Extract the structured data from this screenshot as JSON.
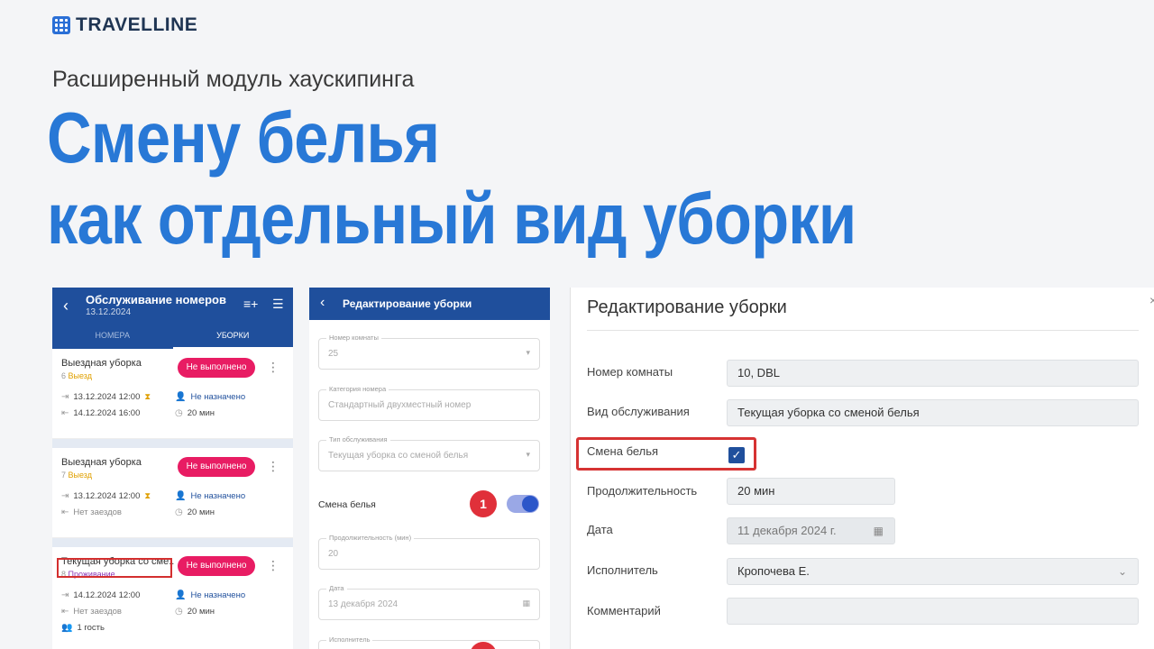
{
  "brand": {
    "name": "TRAVELLINE"
  },
  "subtitle": "Расширенный модуль хаускипинга",
  "headline": {
    "line1": "Смену белья",
    "line2": "как отдельный вид уборки"
  },
  "mobile_list": {
    "title": "Обслуживание номеров",
    "date": "13.12.2024",
    "tabs": [
      "НОМЕРА",
      "УБОРКИ"
    ],
    "cards": [
      {
        "name": "Выездная уборка",
        "room": "6",
        "type": "Выезд",
        "status": "Не выполнено",
        "line1_left": "13.12.2024 12:00",
        "line1_right": "Не назначено",
        "line2_left": "14.12.2024 16:00",
        "line2_right": "20 мин",
        "line3_left": ""
      },
      {
        "name": "Выездная уборка",
        "room": "7",
        "type": "Выезд",
        "status": "Не выполнено",
        "line1_left": "13.12.2024 12:00",
        "line1_right": "Не назначено",
        "line2_left": "Нет заездов",
        "line2_right": "20 мин",
        "line3_left": ""
      },
      {
        "name": "Текущая уборка со сме..",
        "room": "8",
        "type": "Проживание",
        "status": "Не выполнено",
        "line1_left": "14.12.2024 12:00",
        "line1_right": "Не назначено",
        "line2_left": "Нет заездов",
        "line2_right": "20 мин",
        "line3_left": "1 гость"
      }
    ]
  },
  "mobile_edit": {
    "title": "Редактирование уборки",
    "fields": [
      {
        "label": "Номер комнаты",
        "value": "25"
      },
      {
        "label": "Категория номера",
        "value": "Стандартный двухместный номер"
      },
      {
        "label": "Тип обслуживания",
        "value": "Текущая уборка со сменой белья"
      }
    ],
    "switch_label": "Смена белья",
    "switch_on": true,
    "badge": "1",
    "fields2": [
      {
        "label": "Продолжительность (мин)",
        "value": "20"
      },
      {
        "label": "Дата",
        "value": "13 декабря 2024"
      },
      {
        "label": "Исполнитель",
        "value": ""
      }
    ]
  },
  "desktop_edit": {
    "title": "Редактирование уборки",
    "rows": [
      {
        "label": "Номер комнаты",
        "value": "10, DBL"
      },
      {
        "label": "Вид обслуживания",
        "value": "Текущая уборка со сменой белья"
      },
      {
        "label": "Смена белья",
        "value": ""
      },
      {
        "label": "Продолжительность",
        "value": "20 мин"
      },
      {
        "label": "Дата",
        "value": "11 декабря 2024 г."
      },
      {
        "label": "Исполнитель",
        "value": "Кропочева Е."
      },
      {
        "label": "Комментарий",
        "value": ""
      }
    ],
    "linen_checked": true
  },
  "colors": {
    "accent": "#2878d6",
    "header": "#1f4f9c",
    "badge": "#e81c63",
    "highlight": "#d63333"
  }
}
